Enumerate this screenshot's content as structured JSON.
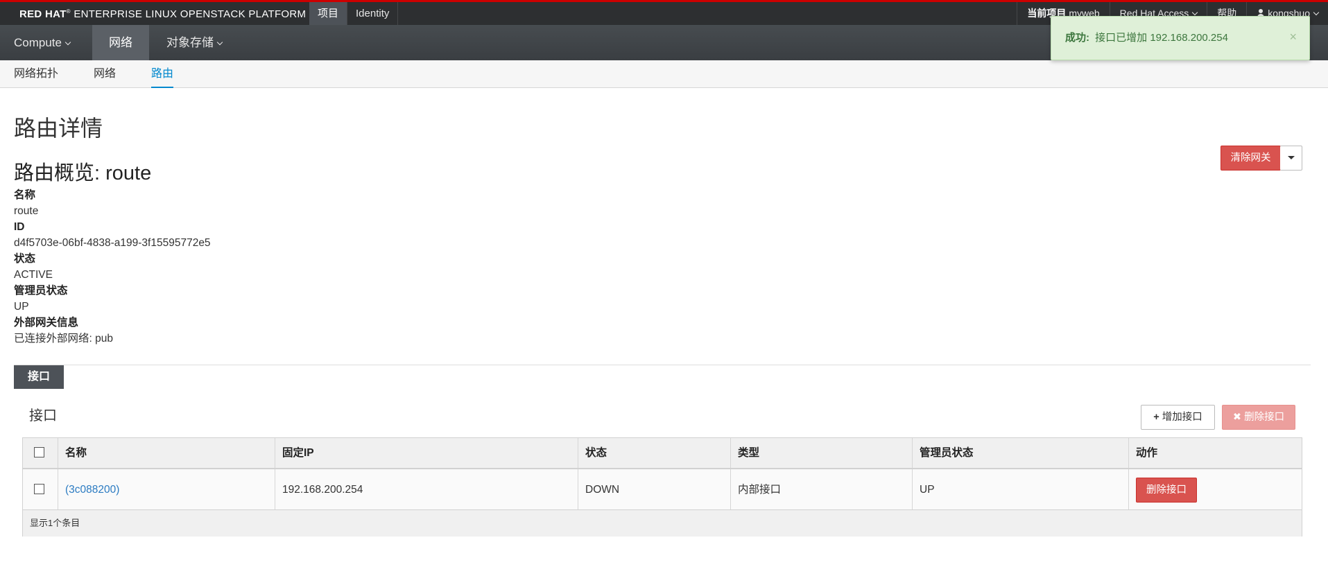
{
  "topbar": {
    "brand_bold": "RED HAT",
    "brand_mark": "®",
    "brand_rest": "ENTERPRISE LINUX OPENSTACK PLATFORM",
    "nav": [
      "项目",
      "Identity"
    ],
    "project_label": "当前项目",
    "project_name": "myweb",
    "access_menu": "Red Hat Access",
    "help": "帮助",
    "user": "kongshuo"
  },
  "secnav": {
    "compute": "Compute",
    "network": "网络",
    "storage": "对象存储"
  },
  "thirdnav": {
    "topology": "网络拓扑",
    "networks": "网络",
    "routers": "路由"
  },
  "alert": {
    "title": "成功:",
    "message": "接口已增加 192.168.200.254",
    "close": "×"
  },
  "page": {
    "title": "路由详情",
    "overview": "路由概览: route",
    "clear_gateway": "清除网关"
  },
  "details": [
    {
      "label": "名称",
      "value": "route"
    },
    {
      "label": "ID",
      "value": "d4f5703e-06bf-4838-a199-3f15595772e5"
    },
    {
      "label": "状态",
      "value": "ACTIVE"
    },
    {
      "label": "管理员状态",
      "value": "UP"
    },
    {
      "label": "外部网关信息",
      "value": "已连接外部网络: pub"
    }
  ],
  "interfaces": {
    "tab": "接口",
    "table_title": "接口",
    "add_button": "增加接口",
    "delete_button": "删除接口",
    "columns": [
      "名称",
      "固定IP",
      "状态",
      "类型",
      "管理员状态",
      "动作"
    ],
    "rows": [
      {
        "name": "(3c088200)",
        "fixed_ip": "192.168.200.254",
        "status": "DOWN",
        "type": "内部接口",
        "admin_state": "UP",
        "action": "删除接口"
      }
    ],
    "footer": "显示1个条目"
  }
}
